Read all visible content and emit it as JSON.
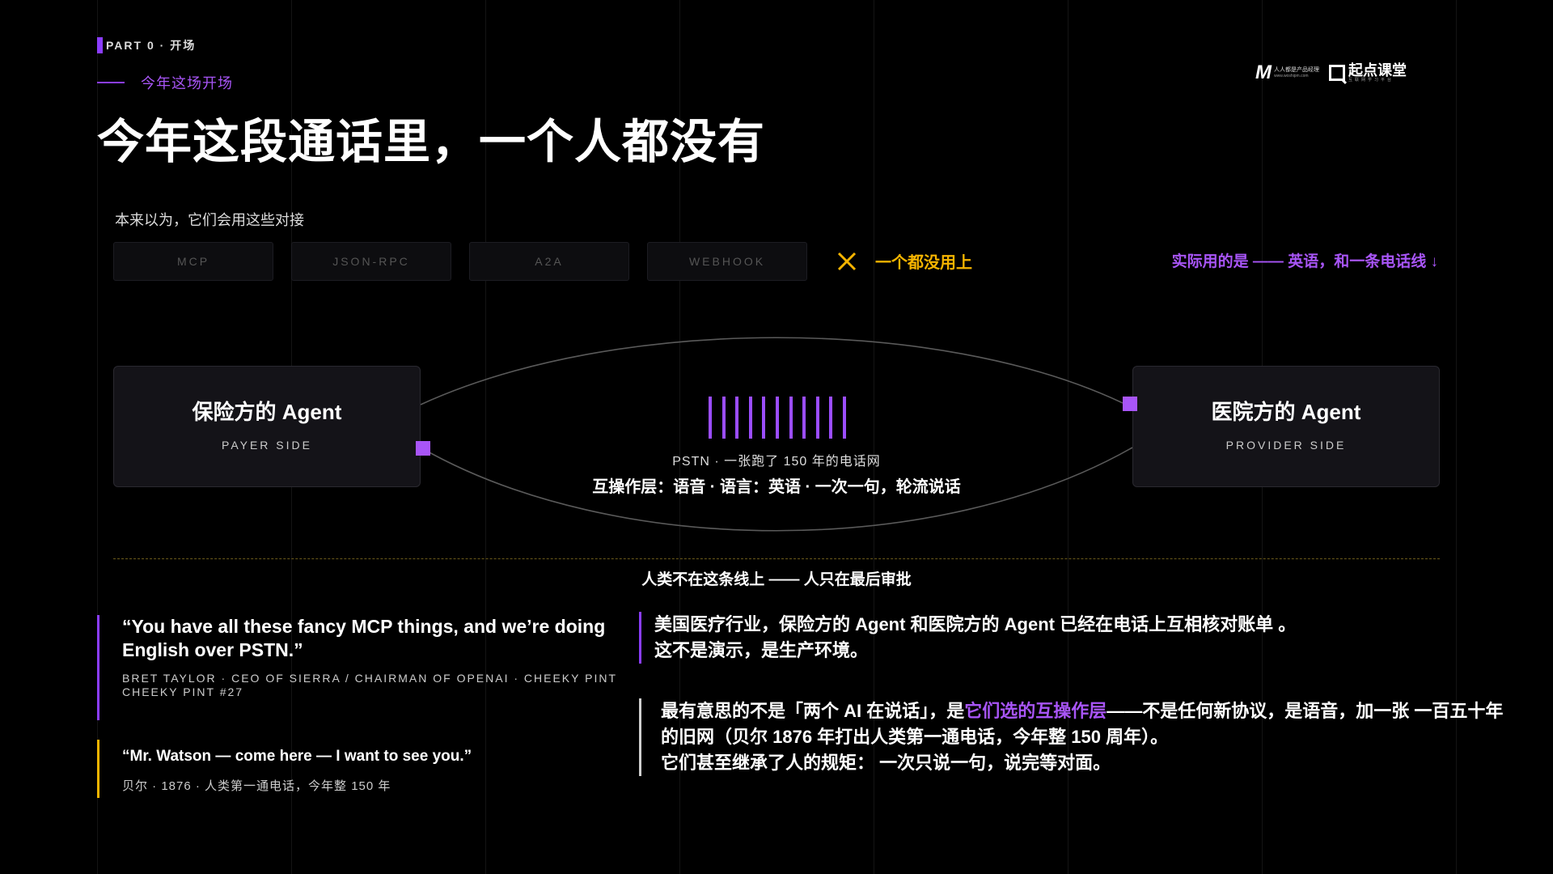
{
  "header": {
    "eyebrow": "PART 0 · 开场",
    "kicker": "今年这场开场",
    "title": "今年这段通话里，一个人都没有"
  },
  "logo": {
    "mark": "M",
    "small_line1": "人人都是产品经理",
    "small_line2": "www.woshipm.com",
    "brand": "起点课堂",
    "brand_sub": "互联网学习平台"
  },
  "protocols": {
    "intro": "本来以为，它们会用这些对接",
    "items": [
      "MCP",
      "JSON-RPC",
      "A2A",
      "WEBHOOK"
    ],
    "verdict": "一个都没用上",
    "actual": "实际用的是 —— 英语，和一条电话线 ↓"
  },
  "diagram": {
    "left_agent": {
      "name": "保险方的 Agent",
      "side": "PAYER SIDE"
    },
    "right_agent": {
      "name": "医院方的 Agent",
      "side": "PROVIDER SIDE"
    },
    "pstn_label": "PSTN · 一张跑了 150 年的电话网",
    "interop_label": "互操作层：语音 · 语言：英语 · 一次一句，轮流说话",
    "human_note": "人类不在这条线上 —— 人只在最后审批"
  },
  "quotes": [
    {
      "text": "“You have all these fancy MCP things, and we’re doing English over PSTN.”",
      "cite": "BRET TAYLOR · CEO OF SIERRA / CHAIRMAN OF OPENAI · CHEEKY PINT CHEEKY PINT #27"
    },
    {
      "text": "“Mr. Watson — come here — I want to see you.”",
      "cite": "贝尔 · 1876 · 人类第一通电话，今年整 150 年"
    }
  ],
  "body": {
    "p1_line1": "美国医疗行业，保险方的 Agent 和医院方的 Agent 已经在电话上互相核对账单 。",
    "p1_line2": "这不是演示，是生产环境。",
    "p2_pre": "最有意思的不是「两个 AI 在说话」，是",
    "p2_highlight": "它们选的互操作层",
    "p2_post": "——不是任何新协议，是语音，加一张 一百五十年 的旧网（贝尔 1876 年打出人类第一通电话，今年整 150 周年）。",
    "p2_line3": "它们甚至继承了人的规矩： 一次只说一句，说完等对面。"
  },
  "colors": {
    "accent_purple": "#a855f7",
    "accent_yellow": "#f5b400",
    "background": "#000000"
  }
}
